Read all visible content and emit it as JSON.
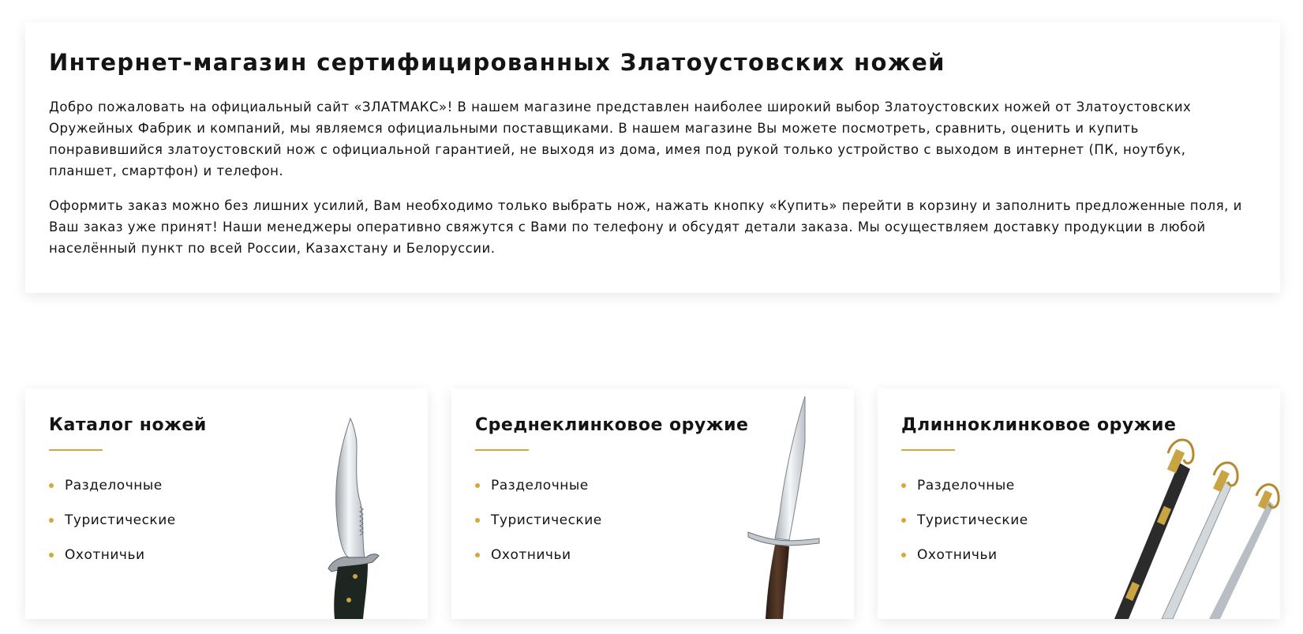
{
  "intro": {
    "title": "Интернет-магазин сертифицированных Златоустовских ножей",
    "paragraph1": "Добро пожаловать на официальный сайт «ЗЛАТМАКС»! В нашем магазине представлен наиболее широкий выбор Златоустовских ножей от Златоустовских Оружейных Фабрик и компаний, мы являемся официальными поставщиками. В нашем магазине Вы можете посмотреть, сравнить, оценить и купить понравившийся златоустовский нож с официальной гарантией, не выходя из дома, имея под рукой только устройство с выходом в интернет (ПК, ноутбук, планшет, смартфон) и телефон.",
    "paragraph2": "Оформить заказ можно без лишних усилий, Вам необходимо только выбрать нож, нажать кнопку «Купить» перейти в корзину и заполнить предложенные поля, и Ваш заказ уже принят! Наши менеджеры оперативно свяжутся с Вами по телефону и обсудят детали заказа. Мы осуществляем доставку продукции в любой населённый пункт по всей России, Казахстану и Белоруссии."
  },
  "categories": [
    {
      "title": "Каталог ножей",
      "items": [
        "Разделочные",
        "Туристические",
        "Охотничьи"
      ],
      "image": "hunting-knife-image"
    },
    {
      "title": "Среднеклинковое оружие",
      "items": [
        "Разделочные",
        "Туристические",
        "Охотничьи"
      ],
      "image": "dagger-image"
    },
    {
      "title": "Длинноклинковое оружие",
      "items": [
        "Разделочные",
        "Туристические",
        "Охотничьи"
      ],
      "image": "sabers-image"
    }
  ],
  "colors": {
    "accent": "#d4a93c",
    "text": "#141414",
    "card_background": "#ffffff"
  }
}
